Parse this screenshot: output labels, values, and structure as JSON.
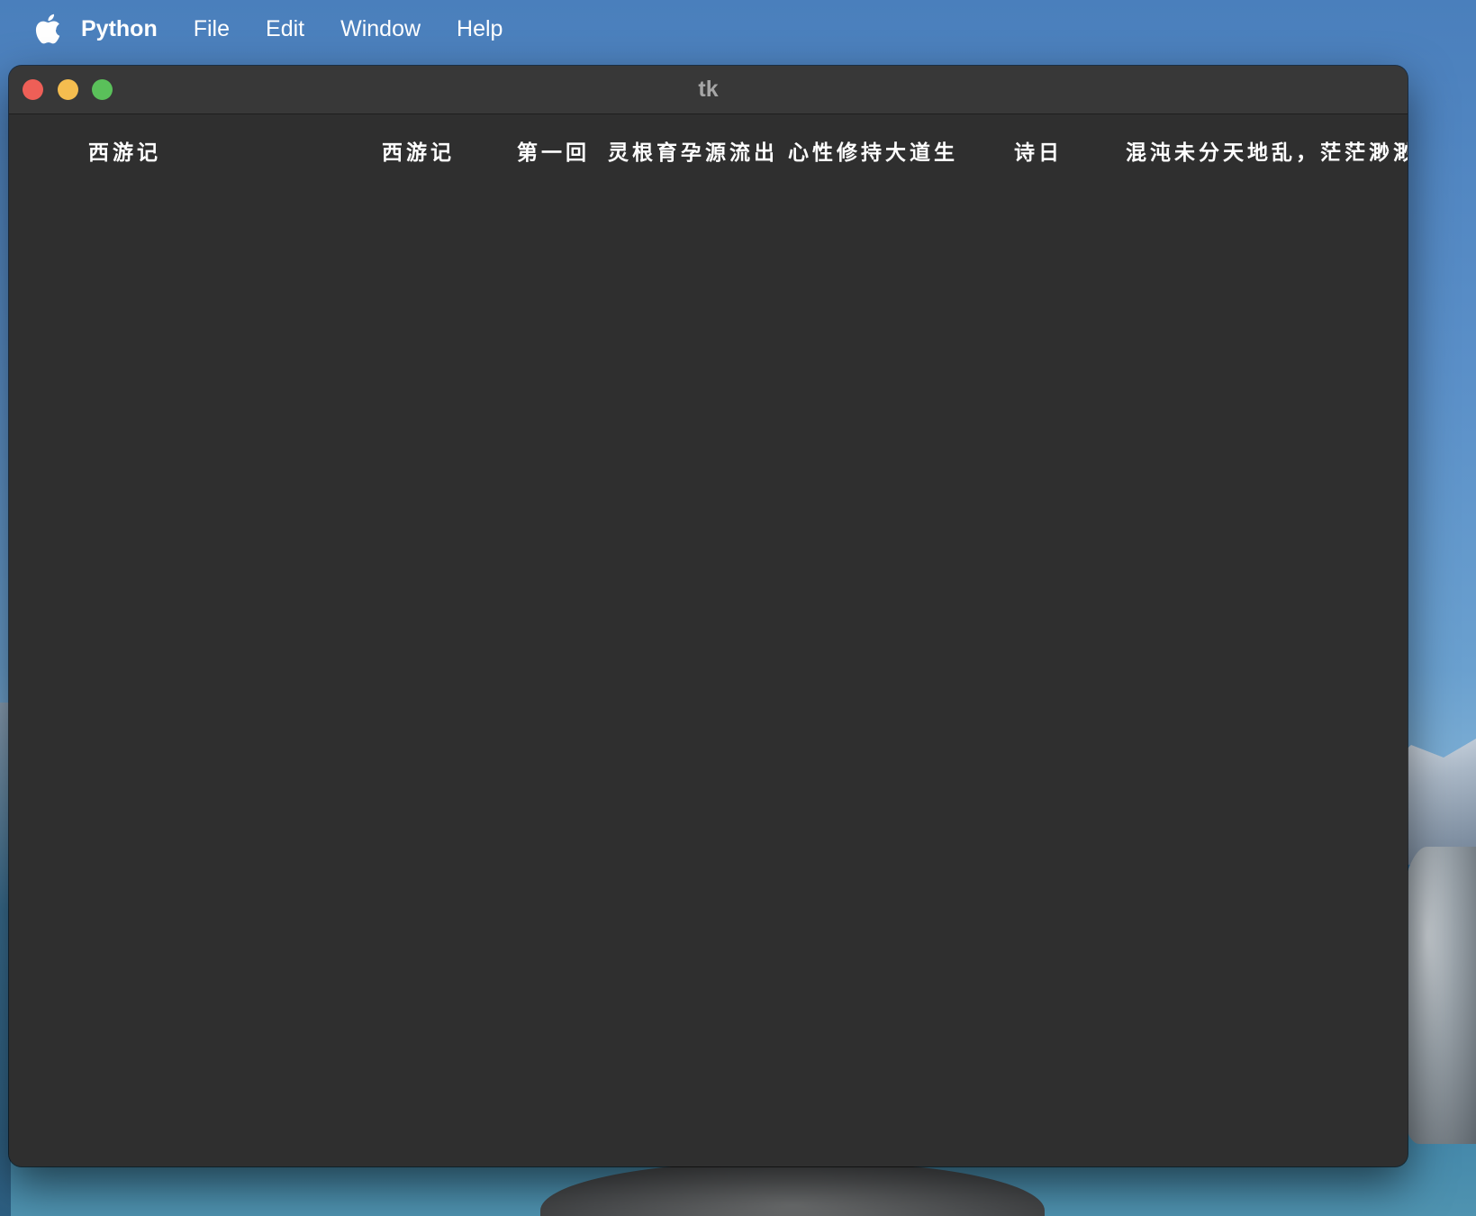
{
  "menubar": {
    "app_name": "Python",
    "items": [
      "File",
      "Edit",
      "Window",
      "Help"
    ]
  },
  "window": {
    "title": "tk",
    "labels": [
      "西游记",
      "西游记",
      "第一回",
      "灵根育孕源流出",
      "心性修持大道生",
      "诗日",
      "混沌未分天地乱，茫茫渺渺无"
    ]
  },
  "colors": {
    "window_bg": "#2f2f2f",
    "titlebar_bg": "#383838",
    "close": "#ee5f57",
    "minimize": "#f5bd4f",
    "maximize": "#5ac05a"
  },
  "icons": [
    "apple-logo-icon"
  ]
}
